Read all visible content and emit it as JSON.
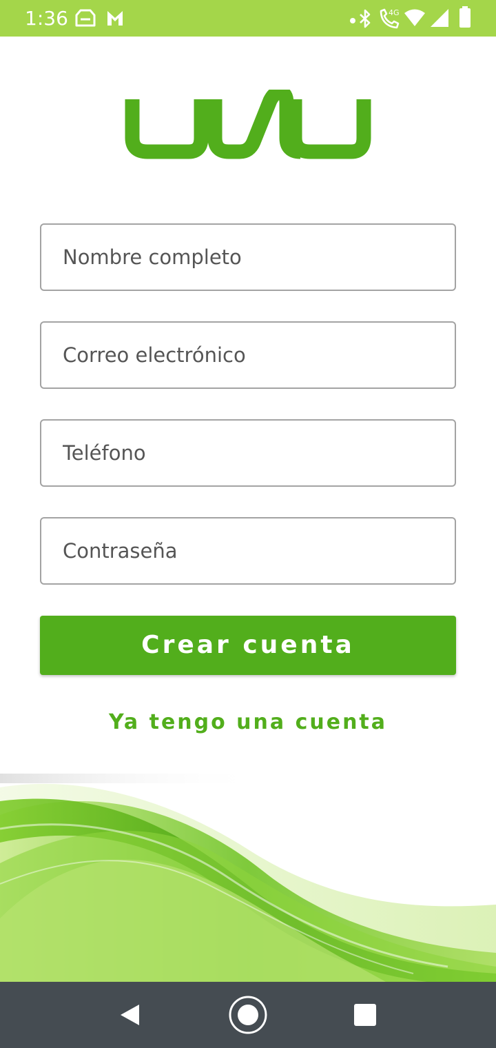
{
  "status_bar": {
    "time": "1:36",
    "network": "4G",
    "icons": [
      "message-icon",
      "gmail-icon",
      "dot-icon",
      "bluetooth-icon",
      "call-4g-icon",
      "wifi-icon",
      "signal-icon",
      "battery-icon"
    ]
  },
  "logo": {
    "text": "uwu",
    "color": "#52ae1c"
  },
  "form": {
    "name_placeholder": "Nombre completo",
    "email_placeholder": "Correo electrónico",
    "phone_placeholder": "Teléfono",
    "password_placeholder": "Contraseña"
  },
  "actions": {
    "create_label": "Crear cuenta",
    "login_label": "Ya tengo una cuenta"
  },
  "nav_bar": {
    "icons": [
      "back-icon",
      "home-icon",
      "recents-icon"
    ]
  },
  "colors": {
    "status_bar": "#a4d64a",
    "accent": "#52ae1c",
    "nav_bar": "#454c52"
  }
}
